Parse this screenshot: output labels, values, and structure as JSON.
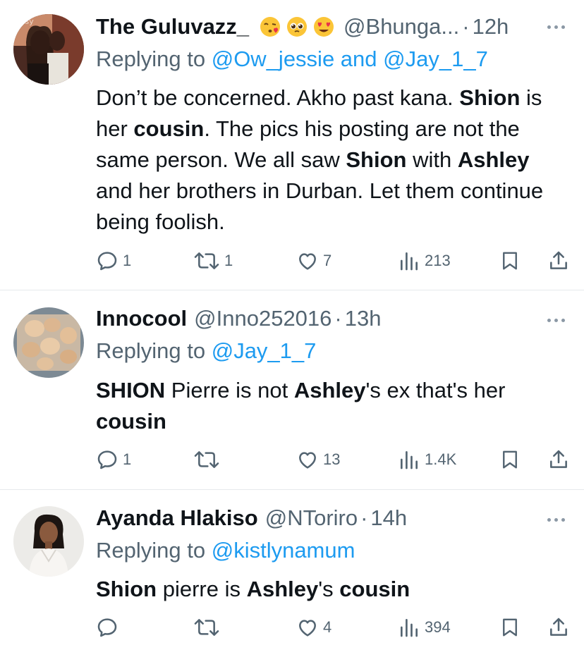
{
  "tweets": [
    {
      "name": "The Guluvazz_",
      "emojis": [
        "kissing-heart-emoji",
        "pleading-face-emoji",
        "heart-eyes-emoji"
      ],
      "handle": "@Bhunga...",
      "sep": "·",
      "time": "12h",
      "replying_prefix": "Replying to ",
      "replying_to": "@Ow_jessie and @Jay_1_7",
      "body": [
        {
          "t": "Don’t be concerned. Akho past kana. ",
          "b": false
        },
        {
          "t": "Shion",
          "b": true
        },
        {
          "t": " is her ",
          "b": false
        },
        {
          "t": "cousin",
          "b": true
        },
        {
          "t": ". The pics his posting are not the same person. We all saw ",
          "b": false
        },
        {
          "t": "Shion",
          "b": true
        },
        {
          "t": " with ",
          "b": false
        },
        {
          "t": "Ashley",
          "b": true
        },
        {
          "t": " and her brothers in Durban. Let them continue being foolish.",
          "b": false
        }
      ],
      "replies": "1",
      "reposts": "1",
      "likes": "7",
      "views": "213"
    },
    {
      "name": "Innocool",
      "handle": "@Inno252016",
      "sep": "·",
      "time": "13h",
      "replying_prefix": "Replying to ",
      "replying_to": "@Jay_1_7",
      "body": [
        {
          "t": "SHION",
          "b": true
        },
        {
          "t": " Pierre is not ",
          "b": false
        },
        {
          "t": "Ashley",
          "b": true
        },
        {
          "t": "'s ex that's her ",
          "b": false
        },
        {
          "t": "cousin",
          "b": true
        }
      ],
      "replies": "1",
      "reposts": "",
      "likes": "13",
      "views": "1.4K"
    },
    {
      "name": "Ayanda Hlakiso",
      "handle": "@NToriro",
      "sep": "·",
      "time": "14h",
      "replying_prefix": "Replying to ",
      "replying_to": "@kistlynamum",
      "body": [
        {
          "t": "Shion",
          "b": true
        },
        {
          "t": " pierre is ",
          "b": false
        },
        {
          "t": "Ashley",
          "b": true
        },
        {
          "t": "'s ",
          "b": false
        },
        {
          "t": "cousin",
          "b": true
        }
      ],
      "replies": "",
      "reposts": "",
      "likes": "4",
      "views": "394"
    }
  ],
  "colors": {
    "text": "#0f1419",
    "secondary": "#536471",
    "link": "#1d9bf0",
    "divider": "#e6e9ec"
  }
}
